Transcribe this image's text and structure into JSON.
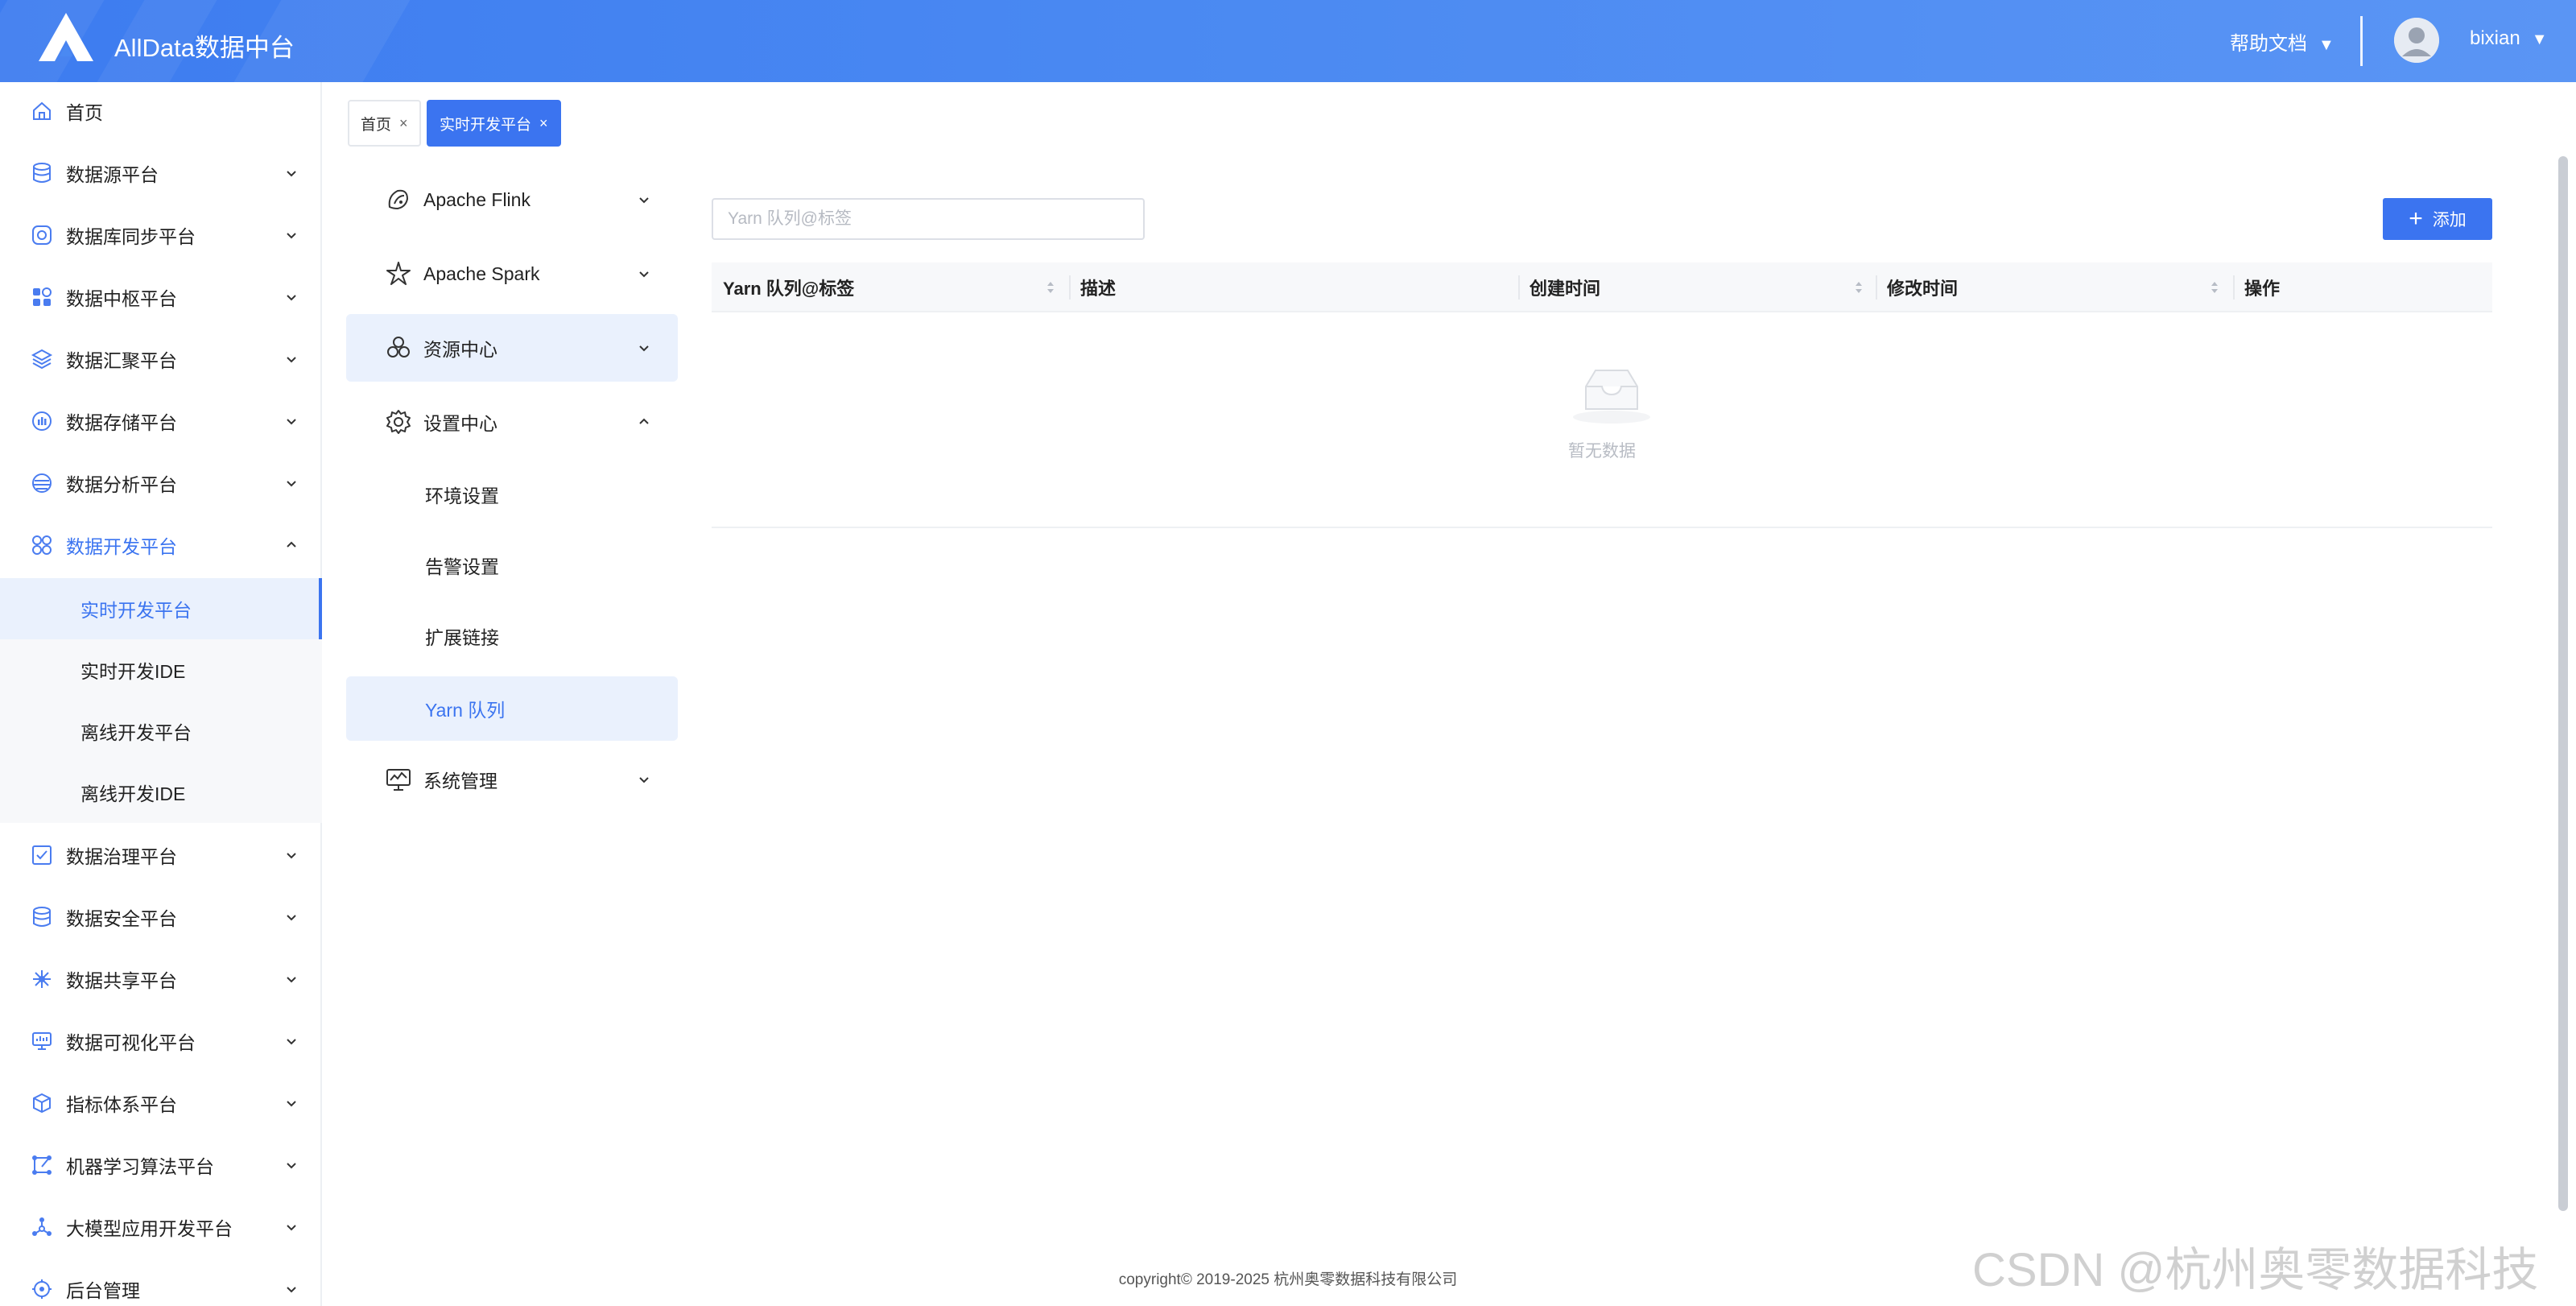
{
  "header": {
    "app_title": "AllData数据中台",
    "help_label": "帮助文档",
    "username": "bixian",
    "caret": "▼"
  },
  "sidebar": {
    "items": [
      {
        "label": "首页",
        "icon": "home-icon"
      },
      {
        "label": "数据源平台",
        "icon": "database-icon"
      },
      {
        "label": "数据库同步平台",
        "icon": "sync-icon"
      },
      {
        "label": "数据中枢平台",
        "icon": "grid-icon"
      },
      {
        "label": "数据汇聚平台",
        "icon": "layers-icon"
      },
      {
        "label": "数据存储平台",
        "icon": "storage-icon"
      },
      {
        "label": "数据分析平台",
        "icon": "analysis-icon"
      },
      {
        "label": "数据开发平台",
        "icon": "dev-icon",
        "active": true
      },
      {
        "label": "数据治理平台",
        "icon": "governance-icon"
      },
      {
        "label": "数据安全平台",
        "icon": "security-icon"
      },
      {
        "label": "数据共享平台",
        "icon": "share-icon"
      },
      {
        "label": "数据可视化平台",
        "icon": "visual-icon"
      },
      {
        "label": "指标体系平台",
        "icon": "cube-icon"
      },
      {
        "label": "机器学习算法平台",
        "icon": "ml-icon"
      },
      {
        "label": "大模型应用开发平台",
        "icon": "llm-icon"
      },
      {
        "label": "后台管理",
        "icon": "admin-icon"
      }
    ],
    "sub_items": [
      {
        "label": "实时开发平台",
        "selected": true
      },
      {
        "label": "实时开发IDE"
      },
      {
        "label": "离线开发平台"
      },
      {
        "label": "离线开发IDE"
      }
    ]
  },
  "tabs": [
    {
      "label": "首页",
      "close": "×"
    },
    {
      "label": "实时开发平台",
      "close": "×",
      "active": true
    }
  ],
  "submenu": {
    "items": [
      {
        "label": "Apache Flink",
        "icon": "flink-icon"
      },
      {
        "label": "Apache Spark",
        "icon": "spark-icon"
      },
      {
        "label": "资源中心",
        "icon": "resource-icon"
      },
      {
        "label": "设置中心",
        "icon": "settings-icon"
      },
      {
        "label": "系统管理",
        "icon": "system-icon"
      }
    ],
    "settings_children": [
      {
        "label": "环境设置"
      },
      {
        "label": "告警设置"
      },
      {
        "label": "扩展链接"
      },
      {
        "label": "Yarn 队列",
        "selected": true
      }
    ]
  },
  "main": {
    "search_placeholder": "Yarn 队列@标签",
    "add_label": "添加",
    "columns": [
      "Yarn 队列@标签",
      "描述",
      "创建时间",
      "修改时间",
      "操作"
    ],
    "empty_text": "暂无数据"
  },
  "footer": {
    "copyright": "copyright© 2019-2025 杭州奥零数据科技有限公司"
  },
  "watermark": "CSDN @杭州奥零数据科技",
  "colors": {
    "primary": "#3b74f0",
    "header_start": "#3d7cf0",
    "selected_bg": "#eaf1fd"
  }
}
